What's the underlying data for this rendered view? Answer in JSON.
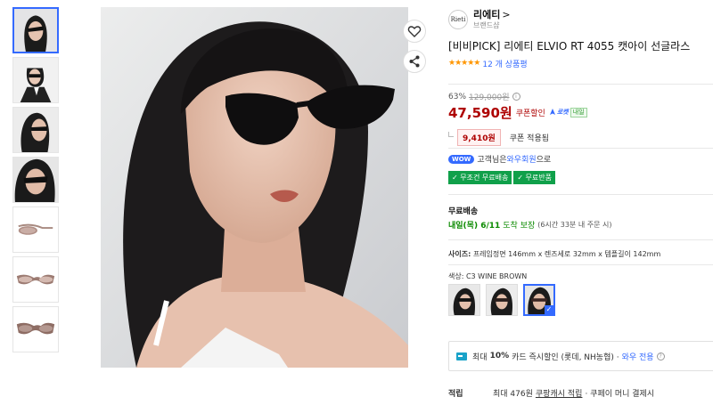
{
  "thumbnails": [
    {
      "kind": "photo-front",
      "selected": true
    },
    {
      "kind": "photo-pose"
    },
    {
      "kind": "photo-side"
    },
    {
      "kind": "photo-close"
    },
    {
      "kind": "product-side"
    },
    {
      "kind": "product-front"
    },
    {
      "kind": "product-angle"
    }
  ],
  "brand": {
    "logo_text": "Rieti",
    "name": "리에티",
    "chevron": ">",
    "shop_label": "브랜드샵"
  },
  "product": {
    "title": "[비비PICK] 리에티 ELVIO RT 4055 캣아이 선글라스",
    "stars": "★★★★★",
    "review_count": "12 개 상품평"
  },
  "price": {
    "discount_rate": "63%",
    "original": "129,000원",
    "info_icon": "i",
    "sale": "47,590원",
    "coupon_label": "쿠폰할인",
    "rocket_label": "로켓",
    "rocket_tag": "내일",
    "coupon_amount": "9,410원",
    "coupon_applied": "쿠폰 적용됨"
  },
  "wow": {
    "badge": "WOW",
    "text_before": "고객님은 ",
    "link": "와우회원",
    "text_after": "으로",
    "benefits": [
      "✓ 무조건 무료배송",
      "✓ 무료반품"
    ]
  },
  "shipping": {
    "title": "무료배송",
    "date": "내일(목) 6/11",
    "guarantee": "도착 보장",
    "cutoff": "(6시간 33분 내 주문 시)"
  },
  "size": {
    "label": "사이즈:",
    "value": " 프레임정면 146mm x 렌즈세로 32mm x 템플길이 142mm"
  },
  "color": {
    "label": "색상:",
    "value": " C3 WINE BROWN",
    "selected_index": 2
  },
  "card": {
    "prefix": "최대",
    "bold": "10%",
    "text": "카드 즉시할인 (롯데, NH농협) ·",
    "wow_only": "와우 전용",
    "help_icon": "?"
  },
  "points": {
    "label": "적립",
    "text": "최대 476원",
    "link": "쿠팡캐시 적립",
    "suffix": "· 쿠페이 머니 결제시"
  },
  "colors": {
    "accent": "#346aff",
    "price_red": "#ae0000",
    "green": "#10a04a",
    "star": "#ff9600"
  }
}
